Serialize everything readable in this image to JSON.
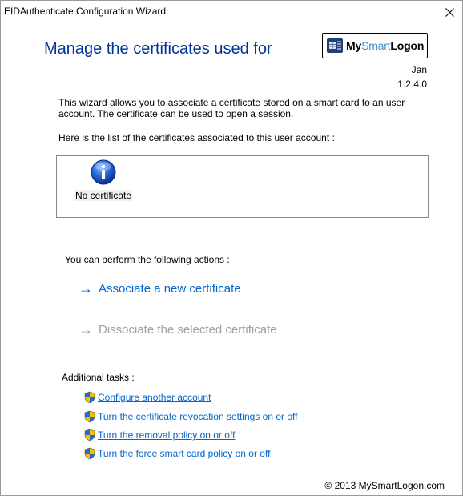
{
  "window": {
    "title": "EIDAuthenticate Configuration Wizard"
  },
  "header": {
    "title": "Manage the certificates used for",
    "logo": {
      "my": "My",
      "smart": "Smart",
      "logon": "Logon"
    },
    "user": "Jan",
    "version": "1.2.4.0"
  },
  "intro": {
    "text": "This wizard allows you to associate a certificate stored on a smart card to an user account. The certificate can be used to open a session.",
    "list_caption": "Here is the list of the certificates associated to this user account :"
  },
  "cert_list": {
    "items": [
      {
        "label": "No certificate",
        "icon": "info-icon"
      }
    ]
  },
  "actions": {
    "caption": "You can perform the following actions :",
    "arrow": "→",
    "associate": "Associate a new certificate",
    "dissociate": "Dissociate the selected certificate"
  },
  "additional": {
    "caption": "Additional tasks :",
    "tasks": [
      {
        "label": "Configure another account",
        "icon": "uac-shield-icon"
      },
      {
        "label": "Turn the certificate revocation settings on or off",
        "icon": "uac-shield-icon"
      },
      {
        "label": "Turn the removal policy on or off",
        "icon": "uac-shield-icon"
      },
      {
        "label": "Turn the force smart card policy on or off",
        "icon": "uac-shield-icon"
      }
    ]
  },
  "footer": {
    "copyright": "© 2013 MySmartLogon.com"
  },
  "colors": {
    "title": "#003399",
    "link": "#0066cc",
    "disabled": "#a0a0a0",
    "logo_accent": "#3d8fd1"
  }
}
